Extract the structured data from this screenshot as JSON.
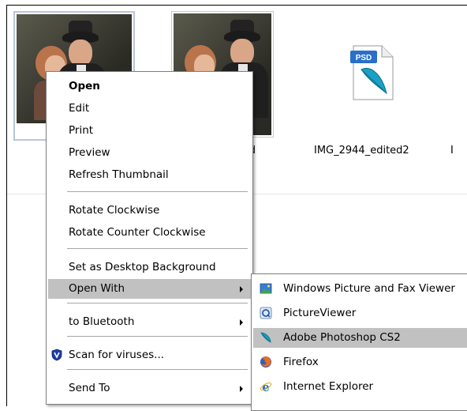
{
  "files": [
    {
      "label": ""
    },
    {
      "label": "ited"
    },
    {
      "label": "IMG_2944_edited2",
      "icon_text": "PSD"
    },
    {
      "label": "I"
    }
  ],
  "context_menu": {
    "items": [
      {
        "label": "Open"
      },
      {
        "label": "Edit"
      },
      {
        "label": "Print"
      },
      {
        "label": "Preview"
      },
      {
        "label": "Refresh Thumbnail"
      },
      {
        "label": "Rotate Clockwise"
      },
      {
        "label": "Rotate Counter Clockwise"
      },
      {
        "label": "Set as Desktop Background"
      },
      {
        "label": "Open With"
      },
      {
        "label": "to Bluetooth"
      },
      {
        "label": "Scan for viruses..."
      },
      {
        "label": "Send To"
      }
    ]
  },
  "open_with_menu": {
    "items": [
      {
        "label": "Windows Picture and Fax Viewer",
        "icon": "picture-viewer-icon"
      },
      {
        "label": "PictureViewer",
        "icon": "quicktime-icon"
      },
      {
        "label": "Adobe Photoshop CS2",
        "icon": "photoshop-feather-icon"
      },
      {
        "label": "Firefox",
        "icon": "firefox-icon"
      },
      {
        "label": "Internet Explorer",
        "icon": "internet-explorer-icon"
      }
    ]
  },
  "colors": {
    "menu_highlight": "#c1c1c1",
    "selection_border": "#b8c5dd"
  }
}
